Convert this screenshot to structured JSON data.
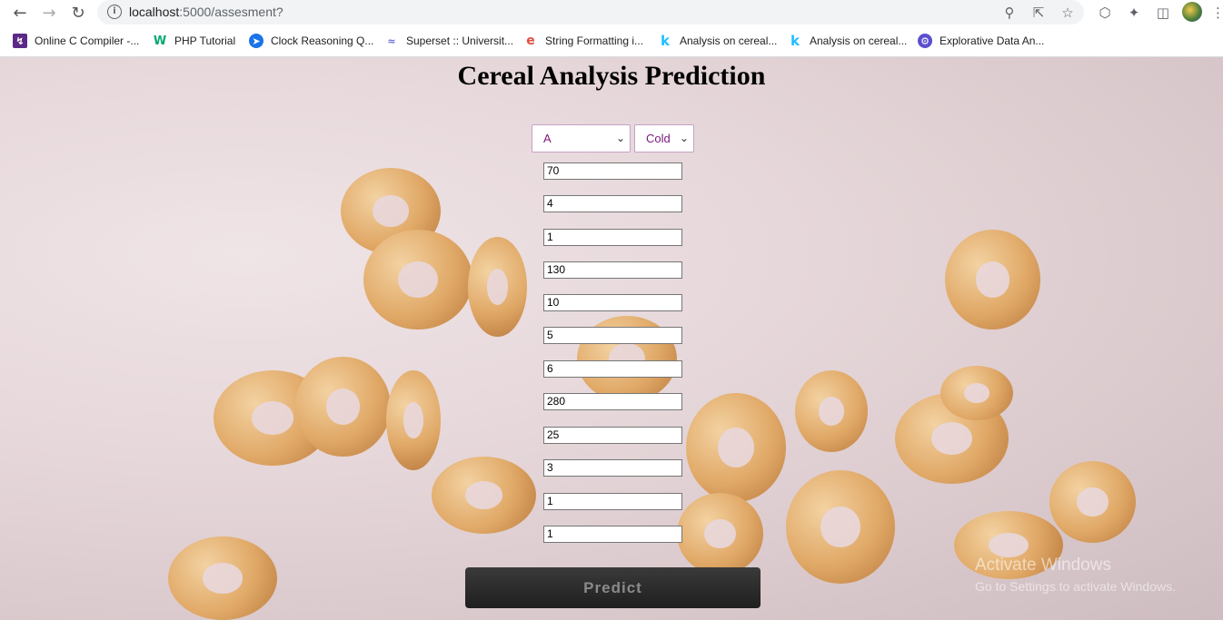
{
  "browser": {
    "url_host": "localhost",
    "url_path": ":5000/assesment?",
    "bookmarks": [
      {
        "label": "Online C Compiler -...",
        "icon": "lightning-icon",
        "color": "#5b2a86"
      },
      {
        "label": "PHP Tutorial",
        "icon": "w3schools-icon",
        "color": "#04aa6d"
      },
      {
        "label": "Clock Reasoning Q...",
        "icon": "circle-logo-icon",
        "color": "#1a73e8"
      },
      {
        "label": "Superset :: Universit...",
        "icon": "superset-icon",
        "color": "#6b6bd6"
      },
      {
        "label": "String Formatting i...",
        "icon": "e-logo-icon",
        "color": "#e04f3f"
      },
      {
        "label": "Analysis on cereal...",
        "icon": "kaggle-icon",
        "color": "#20beff"
      },
      {
        "label": "Analysis on cereal...",
        "icon": "kaggle-icon",
        "color": "#20beff"
      },
      {
        "label": "Explorative Data An...",
        "icon": "gear-logo-icon",
        "color": "#5a4fcf"
      }
    ]
  },
  "page": {
    "title": "Cereal Analysis Prediction",
    "select_mfr": "A",
    "select_type": "Cold",
    "fields": [
      "70",
      "4",
      "1",
      "130",
      "10",
      "5",
      "6",
      "280",
      "25",
      "3",
      "1",
      "1"
    ],
    "predict_label": "Predict",
    "watermark_line1": "Activate Windows",
    "watermark_line2": "Go to Settings to activate Windows."
  }
}
